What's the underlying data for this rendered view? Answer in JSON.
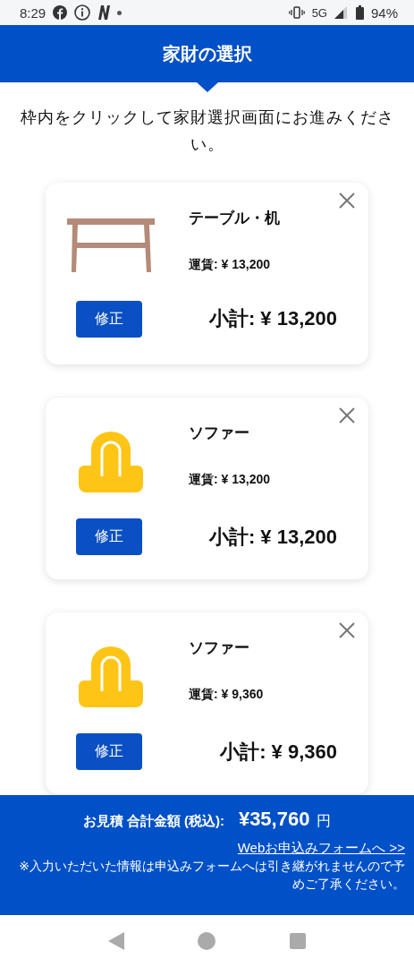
{
  "status_bar": {
    "time": "8:29",
    "network": "5G",
    "battery": "94%"
  },
  "header": {
    "title": "家財の選択"
  },
  "instruction": "枠内をクリックして家財選択画面にお進みください。",
  "items": [
    {
      "kind": "table",
      "name": "テーブル・机",
      "fare": "運賃: ¥ 13,200",
      "edit_button": "修正",
      "subtotal": "小計: ¥ 13,200"
    },
    {
      "kind": "sofa",
      "name": "ソファー",
      "fare": "運賃: ¥ 13,200",
      "edit_button": "修正",
      "subtotal": "小計: ¥ 13,200"
    },
    {
      "kind": "sofa",
      "name": "ソファー",
      "fare": "運賃: ¥ 9,360",
      "edit_button": "修正",
      "subtotal": "小計: ¥ 9,360"
    }
  ],
  "footer": {
    "total_label": "お見積 合計金額 (税込):",
    "total_amount": "¥35,760",
    "total_unit": "円",
    "form_link": "Webお申込みフォームへ >>",
    "notice": "※入力いただいた情報は申込みフォームへは引き継がれませんので予めご了承ください。"
  }
}
